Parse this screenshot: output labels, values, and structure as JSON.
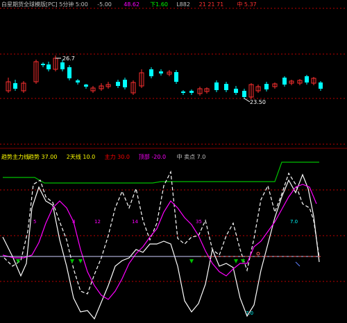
{
  "header": {
    "title": "白星期货全球模版[PC] 5分钟 5:00",
    "items": [
      {
        "text": "-5.00",
        "color": "#c0c0c0"
      },
      {
        "text": "48.62",
        "color": "#ff00ff"
      },
      {
        "text": "下1.60",
        "color": "#00ff00"
      },
      {
        "text": "L882",
        "color": "#c0c0c0"
      },
      {
        "text": "21 21 71",
        "color": "#ff3030"
      },
      {
        "text": "中 5.37",
        "color": "#ff3030"
      }
    ]
  },
  "upper": {
    "high_label": "26.7",
    "low_label": "23.50"
  },
  "lower": {
    "title": "趋势主力线",
    "params": [
      {
        "text": "趋势 37.00",
        "color": "#ffff00"
      },
      {
        "text": "2天线 10.0",
        "color": "#ffff00"
      },
      {
        "text": "主力 30.0",
        "color": "#ff0000"
      },
      {
        "text": "顶部 -20.0",
        "color": "#ff00ff"
      },
      {
        "text": "中 卖点 7.0",
        "color": "#c0c0c0"
      }
    ],
    "value_labels": [
      {
        "text": "5",
        "color": "#ff00ff"
      },
      {
        "text": "8",
        "color": "#ff00ff"
      },
      {
        "text": "12",
        "color": "#ff00ff"
      },
      {
        "text": "14",
        "color": "#ff00ff"
      },
      {
        "text": "35",
        "color": "#ff00ff"
      },
      {
        "text": "7.0",
        "color": "#00ffff"
      }
    ]
  },
  "colors": {
    "grid": "#c00000",
    "up": "#ff3030",
    "down": "#00ffff",
    "white": "#ffffff",
    "green": "#00c000",
    "magenta": "#ff00ff",
    "yellow": "#ffff00"
  }
}
